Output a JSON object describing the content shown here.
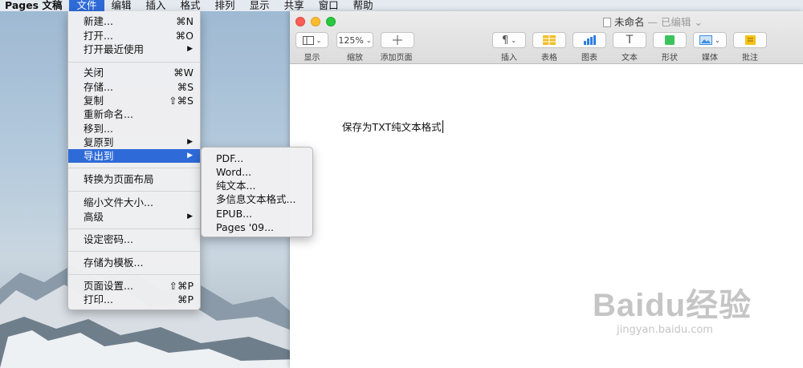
{
  "menubar": {
    "items": [
      "Pages 文稿",
      "文件",
      "编辑",
      "插入",
      "格式",
      "排列",
      "显示",
      "共享",
      "窗口",
      "帮助"
    ]
  },
  "window": {
    "title": "未命名",
    "edited_suffix": "— 已编辑 ⌄"
  },
  "toolbar": {
    "view": {
      "label": "显示",
      "icon": "sidebar-icon"
    },
    "zoom": {
      "label": "缩放",
      "value": "125%"
    },
    "add_page": {
      "label": "添加页面",
      "icon": "plus-icon"
    },
    "insert": {
      "label": "插入",
      "icon": "pilcrow-icon"
    },
    "table": {
      "label": "表格",
      "icon": "table-icon",
      "color": "#f2bf2a"
    },
    "chart": {
      "label": "图表",
      "icon": "bar-chart-icon",
      "color": "#2f7fe0"
    },
    "text": {
      "label": "文本",
      "icon": "text-icon",
      "glyph": "T"
    },
    "shape": {
      "label": "形状",
      "icon": "shape-icon",
      "color": "#3cc45c"
    },
    "media": {
      "label": "媒体",
      "icon": "media-icon",
      "color": "#3d8ee0"
    },
    "comment": {
      "label": "批注",
      "icon": "comment-icon",
      "color": "#f5c21b"
    }
  },
  "document": {
    "text": "保存为TXT纯文本格式"
  },
  "file_menu": {
    "items": [
      {
        "label": "新建...",
        "shortcut": "⌘N"
      },
      {
        "label": "打开...",
        "shortcut": "⌘O"
      },
      {
        "label": "打开最近使用",
        "submenu": true
      },
      {
        "label": "关闭",
        "shortcut": "⌘W"
      },
      {
        "label": "存储...",
        "shortcut": "⌘S"
      },
      {
        "label": "复制",
        "shortcut": "⇧⌘S"
      },
      {
        "label": "重新命名..."
      },
      {
        "label": "移到..."
      },
      {
        "label": "复原到",
        "submenu": true
      },
      {
        "label": "导出到",
        "submenu": true,
        "highlighted": true
      },
      {
        "label": "转换为页面布局"
      },
      {
        "label": "缩小文件大小..."
      },
      {
        "label": "高级",
        "submenu": true
      },
      {
        "label": "设定密码..."
      },
      {
        "label": "存储为模板..."
      },
      {
        "label": "页面设置...",
        "shortcut": "⇧⌘P"
      },
      {
        "label": "打印...",
        "shortcut": "⌘P"
      }
    ],
    "submenu_arrow": "▶"
  },
  "export_submenu": {
    "items": [
      "PDF...",
      "Word...",
      "纯文本...",
      "多信息文本格式...",
      "EPUB...",
      "Pages '09..."
    ]
  },
  "watermark": {
    "brand": "Baidu经验",
    "site": "jingyan.baidu.com"
  },
  "colors": {
    "menu_highlight": "#2f6bd8"
  }
}
